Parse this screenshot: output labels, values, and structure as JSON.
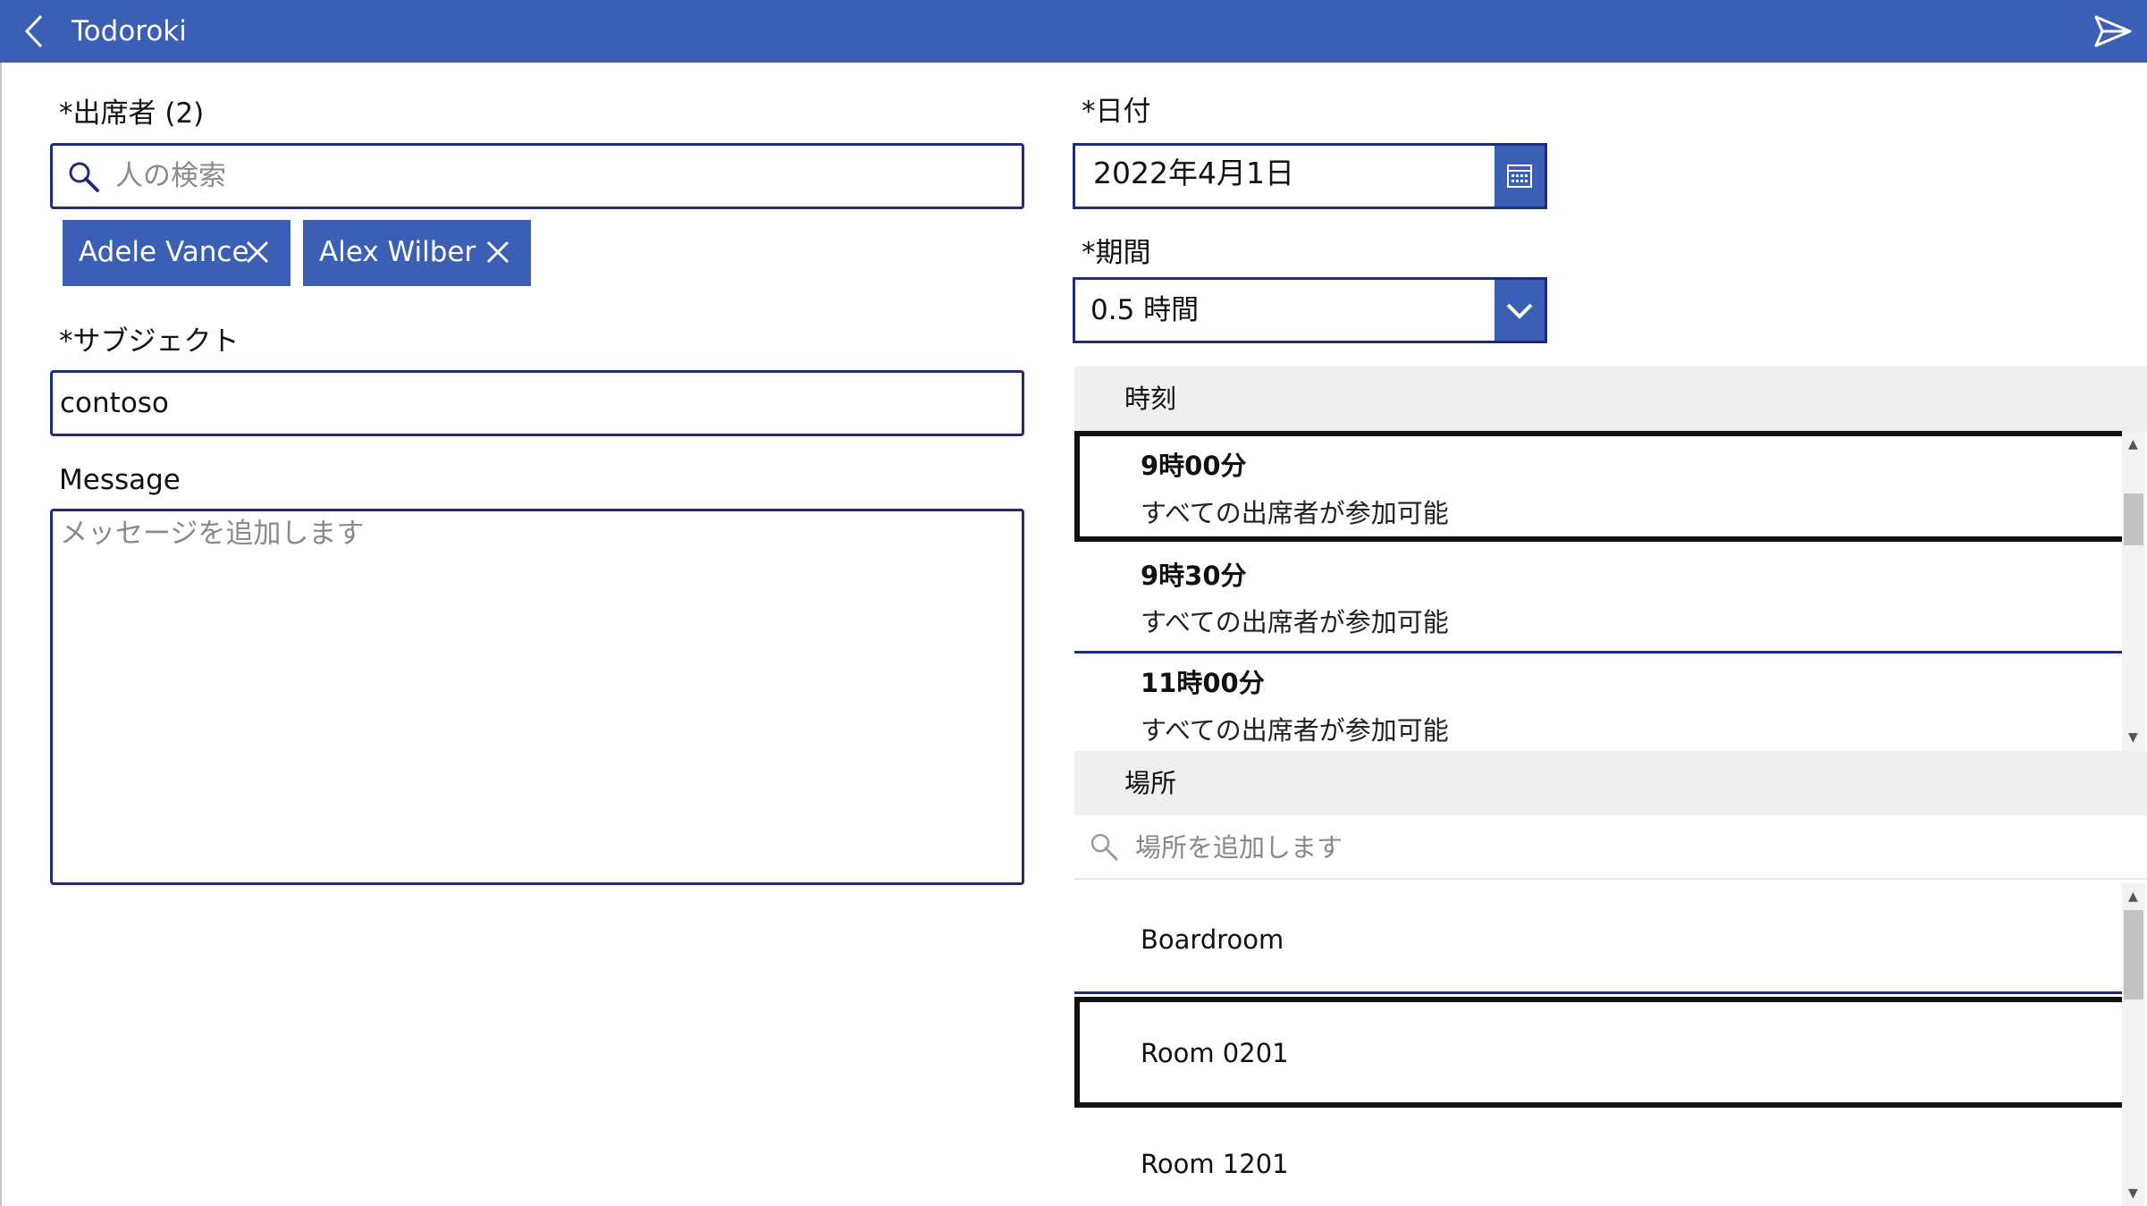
{
  "header": {
    "title": "Todoroki",
    "back_icon": "chevron-left-icon",
    "send_icon": "send-icon",
    "background": "#3b5fb4"
  },
  "attendees": {
    "label": "*出席者 (2)",
    "search_placeholder": "人の検索",
    "chips": [
      {
        "name": "Adele Vance"
      },
      {
        "name": "Alex Wilber"
      }
    ]
  },
  "subject": {
    "label": "*サブジェクト",
    "value": "contoso"
  },
  "message": {
    "label": "Message",
    "placeholder": "メッセージを追加します"
  },
  "date": {
    "label": "*日付",
    "value": "2022年4月1日",
    "icon": "calendar-icon"
  },
  "duration": {
    "label": "*期間",
    "value": "0.5 時間",
    "icon": "chevron-down-icon"
  },
  "times": {
    "header": "時刻",
    "items": [
      {
        "time": "9時00分",
        "status": "すべての出席者が参加可能"
      },
      {
        "time": "9時30分",
        "status": "すべての出席者が参加可能"
      },
      {
        "time": "11時00分",
        "status": "すべての出席者が参加可能"
      }
    ]
  },
  "location": {
    "header": "場所",
    "search_placeholder": "場所を追加します",
    "rooms": [
      "Boardroom",
      "Room 0201",
      "Room 1201"
    ]
  },
  "colors": {
    "accent": "#3b5fb4",
    "border": "#1f2c7a"
  }
}
